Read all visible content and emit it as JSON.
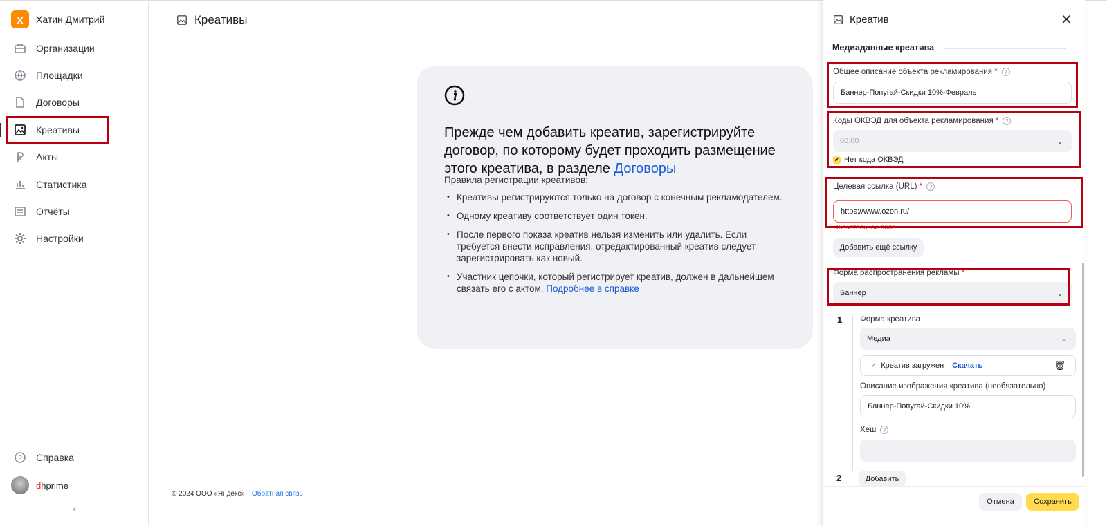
{
  "user": {
    "name": "Хатин Дмитрий",
    "logo_letter": "x"
  },
  "sidebar": {
    "items": [
      {
        "label": "Организации",
        "icon": "briefcase-icon"
      },
      {
        "label": "Площадки",
        "icon": "globe-icon"
      },
      {
        "label": "Договоры",
        "icon": "document-icon"
      },
      {
        "label": "Креативы",
        "icon": "image-icon"
      },
      {
        "label": "Акты",
        "icon": "ruble-icon"
      },
      {
        "label": "Статистика",
        "icon": "chart-icon"
      },
      {
        "label": "Отчёты",
        "icon": "report-icon"
      },
      {
        "label": "Настройки",
        "icon": "gear-icon"
      }
    ],
    "help": "Справка",
    "account_first": "d",
    "account_rest": "hprime"
  },
  "header": {
    "title": "Креативы"
  },
  "card": {
    "heading": "Прежде чем добавить креатив, зарегистрируйте договор, по которому будет проходить размещение этого креатива, в разделе ",
    "heading_link": "Договоры",
    "rules_title": "Правила регистрации креативов:",
    "rules": [
      "Креативы регистрируются только на договор с конечным рекламодателем.",
      "Одному креативу соответствует один токен.",
      "После первого показа креатив нельзя изменить или удалить. Если требуется внести исправления, отредактированный креатив следует зарегистрировать как новый."
    ],
    "rule4": "Участник цепочки, который регистрирует креатив, должен в дальнейшем связать его с актом. ",
    "rule4_link": "Подробнее в справке"
  },
  "footer": {
    "copyright": "© 2024 ООО «Яндекс»",
    "feedback": "Обратная связь"
  },
  "panel": {
    "title": "Креатив",
    "section": "Медиаданные креатива",
    "description_label": "Общее описание объекта рекламирования",
    "description_value": "Баннер-Попугай-Скидки 10%-Февраль",
    "okved_label": "Коды ОКВЭД для объекта рекламирования",
    "okved_placeholder": "00.00",
    "no_okved": "Нет кода ОКВЭД",
    "no_okved_checked": true,
    "url_label": "Целевая ссылка (URL)",
    "url_value": "https://www.ozon.ru/",
    "url_error": "Обязательное поле",
    "add_link": "Добавить ещё ссылку",
    "distribution_label": "Форма распространения рекламы",
    "distribution_value": "Баннер",
    "item1_num": "1",
    "creative_form_label": "Форма креатива",
    "creative_form_value": "Медиа",
    "uploaded": "Креатив загружен",
    "download": "Скачать",
    "image_desc_label": "Описание изображения креатива (необязательно)",
    "image_desc_value": "Баннер-Попугай-Скидки 10%",
    "hash_label": "Хеш",
    "hash_value": "",
    "item2_num": "2",
    "add": "Добавить",
    "cancel": "Отмена",
    "save": "Сохранить"
  },
  "colors": {
    "accent": "#ffdb4d",
    "link": "#1a5bd6",
    "highlight": "#b80010",
    "logo": "#fc8b00"
  }
}
